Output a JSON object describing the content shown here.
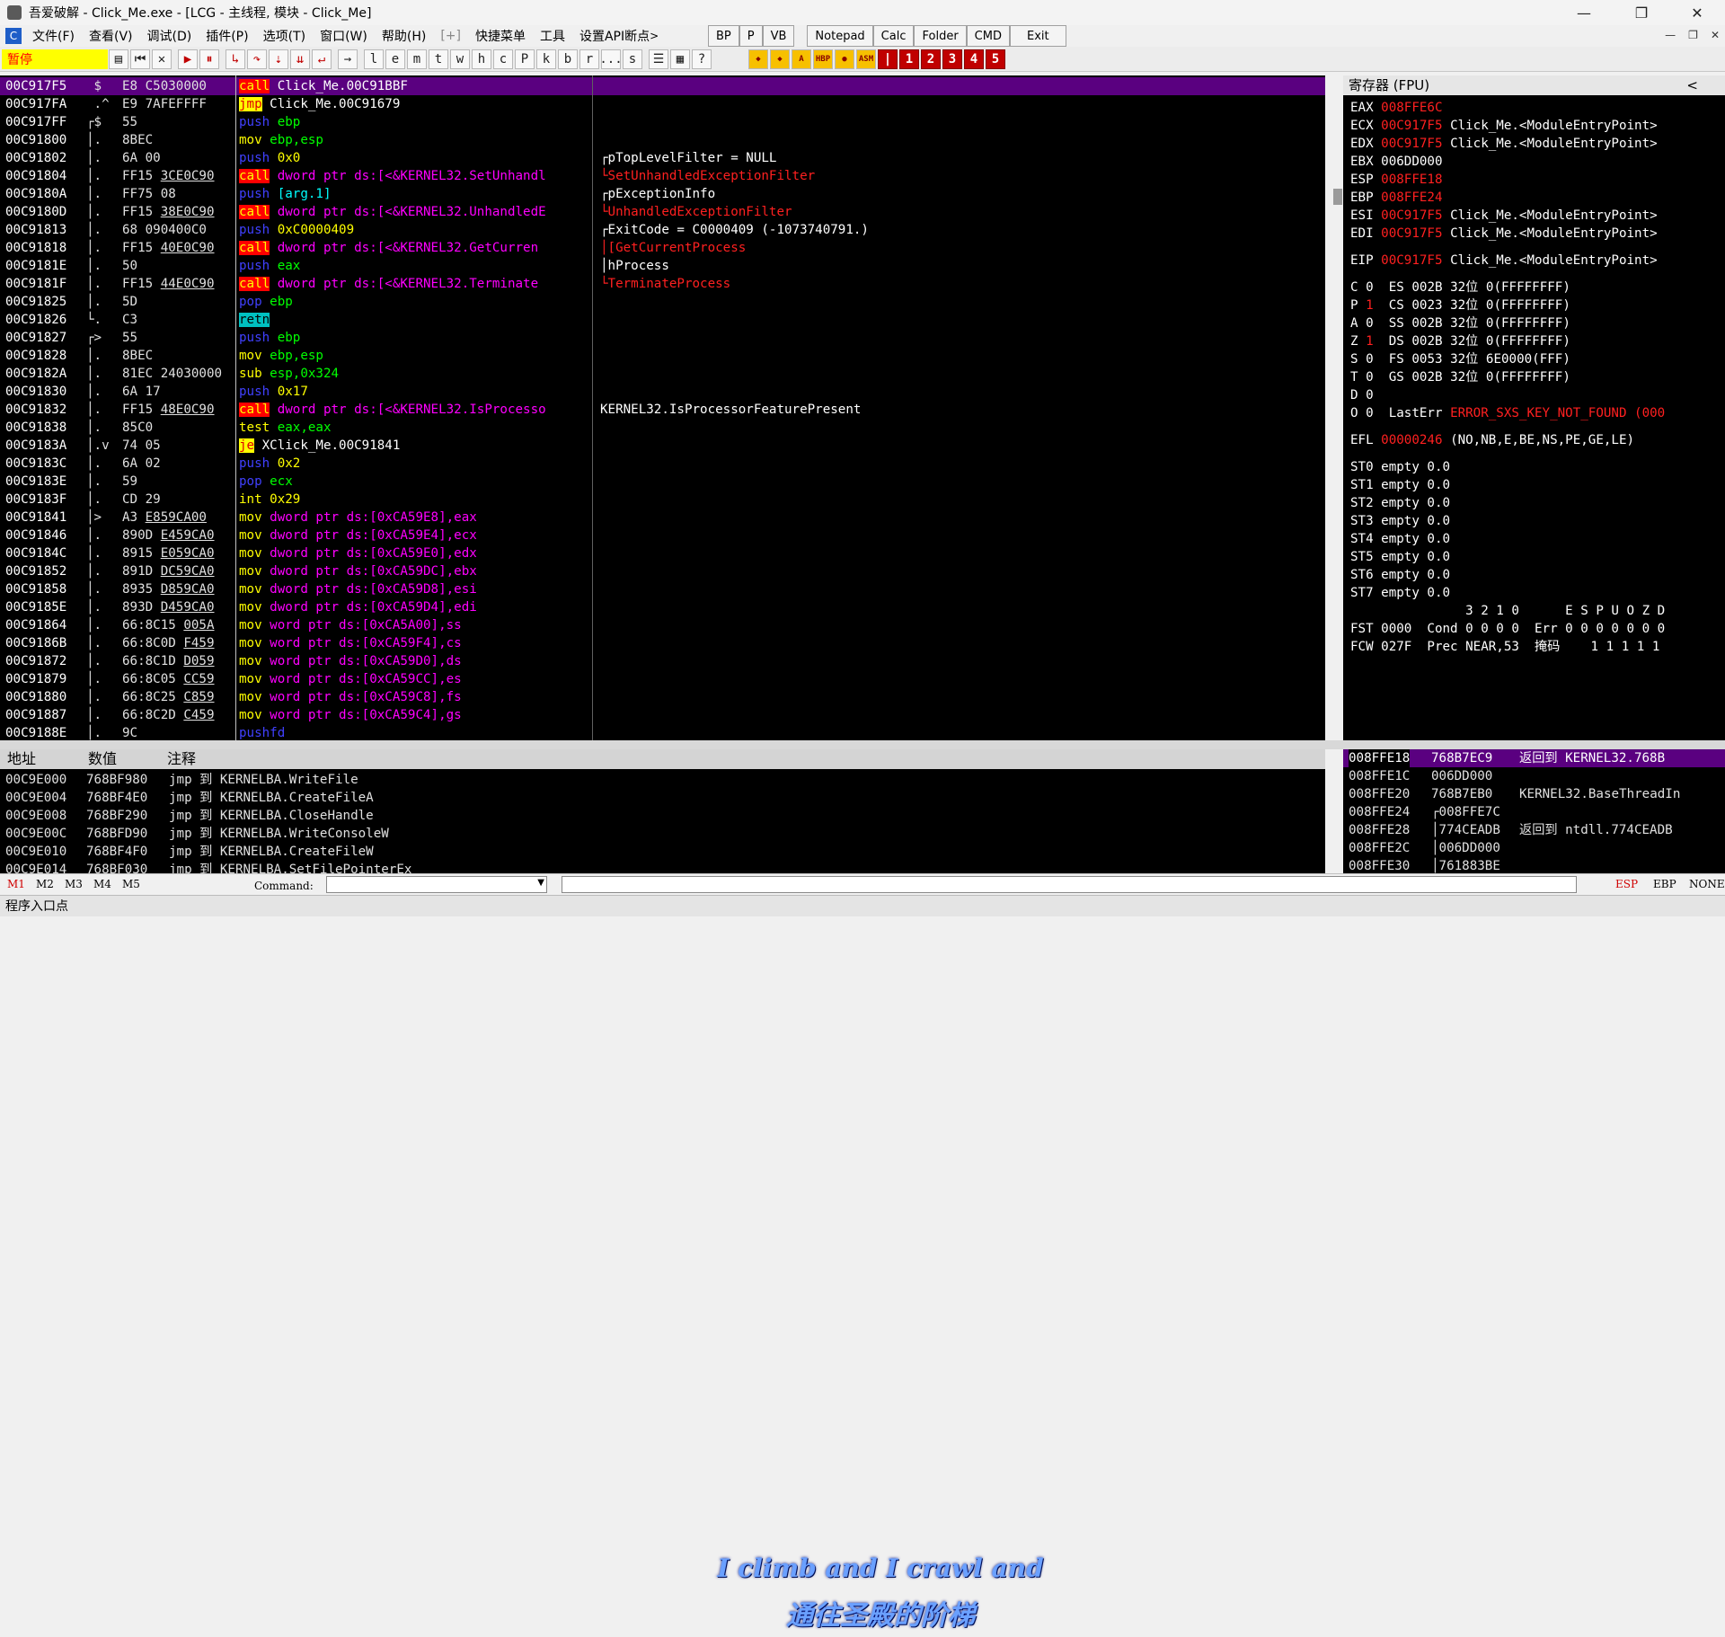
{
  "window": {
    "title": "吾爱破解 - Click_Me.exe - [LCG - 主线程, 模块 - Click_Me]",
    "minimize": "—",
    "maximize": "❐",
    "close": "✕"
  },
  "menu": {
    "app_icon": "C",
    "items": [
      "文件(F)",
      "查看(V)",
      "调试(D)",
      "插件(P)",
      "选项(T)",
      "窗口(W)",
      "帮助(H)",
      "[+]",
      "快捷菜单",
      "工具",
      "设置API断点"
    ],
    "arrow": ">",
    "quick": [
      "BP",
      "P",
      "VB",
      "Notepad",
      "Calc",
      "Folder",
      "CMD",
      "Exit"
    ]
  },
  "toolbar": {
    "status": "暂停",
    "letters": [
      "l",
      "e",
      "m",
      "t",
      "w",
      "h",
      "c",
      "P",
      "k",
      "b",
      "r",
      "...",
      "s"
    ],
    "numbers": [
      "1",
      "2",
      "3",
      "4",
      "5"
    ]
  },
  "cpu_rows": [
    {
      "addr": "00C917F5",
      "jc": " $",
      "hex": "E8 C5030000",
      "ul": "",
      "mn": "call",
      "mc": "call",
      "op": "Click_Me.00C91BBF",
      "oc": "tgt",
      "cm": "",
      "cc": "",
      "sel": true
    },
    {
      "addr": "00C917FA",
      "jc": " .^",
      "hex": "E9 7AFEFFFF",
      "ul": "",
      "mn": "jmp",
      "mc": "jmp",
      "op": "Click_Me.00C91679",
      "oc": "tgt",
      "cm": "",
      "cc": ""
    },
    {
      "addr": "00C917FF",
      "jc": "┌$",
      "hex": "55",
      "ul": "",
      "mn": "push",
      "mc": "push",
      "op": "ebp",
      "oc": "reg",
      "cm": "",
      "cc": ""
    },
    {
      "addr": "00C91800",
      "jc": "│.",
      "hex": "8BEC",
      "ul": "",
      "mn": "mov",
      "mc": "mov",
      "op": "ebp,esp",
      "oc": "reg",
      "cm": "",
      "cc": ""
    },
    {
      "addr": "00C91802",
      "jc": "│.",
      "hex": "6A 00",
      "ul": "",
      "mn": "push",
      "mc": "push",
      "op": "0x0",
      "oc": "num",
      "cm": "┌pTopLevelFilter = NULL",
      "cc": ""
    },
    {
      "addr": "00C91804",
      "jc": "│.",
      "hex": "FF15 ",
      "ul": "3CE0C90",
      "mn": "call",
      "mc": "call",
      "op": "dword ptr ds:[<&KERNEL32.SetUnhandl",
      "oc": "str",
      "cm": "└SetUnhandledExceptionFilter",
      "cc": "red"
    },
    {
      "addr": "00C9180A",
      "jc": "│.",
      "hex": "FF75 08",
      "ul": "",
      "mn": "push",
      "mc": "push",
      "op": "[arg.1]",
      "oc": "arg",
      "cm": "┌pExceptionInfo",
      "cc": ""
    },
    {
      "addr": "00C9180D",
      "jc": "│.",
      "hex": "FF15 ",
      "ul": "38E0C90",
      "mn": "call",
      "mc": "call",
      "op": "dword ptr ds:[<&KERNEL32.UnhandledE",
      "oc": "str",
      "cm": "└UnhandledExceptionFilter",
      "cc": "red"
    },
    {
      "addr": "00C91813",
      "jc": "│.",
      "hex": "68 090400C0",
      "ul": "",
      "mn": "push",
      "mc": "push",
      "op": "0xC0000409",
      "oc": "num",
      "cm": "┌ExitCode = C0000409 (-1073740791.)",
      "cc": ""
    },
    {
      "addr": "00C91818",
      "jc": "│.",
      "hex": "FF15 ",
      "ul": "40E0C90",
      "mn": "call",
      "mc": "call",
      "op": "dword ptr ds:[<&KERNEL32.GetCurren",
      "oc": "str",
      "cm": "│[GetCurrentProcess",
      "cc": "red"
    },
    {
      "addr": "00C9181E",
      "jc": "│.",
      "hex": "50",
      "ul": "",
      "mn": "push",
      "mc": "push",
      "op": "eax",
      "oc": "reg",
      "cm": "│hProcess",
      "cc": ""
    },
    {
      "addr": "00C9181F",
      "jc": "│.",
      "hex": "FF15 ",
      "ul": "44E0C90",
      "mn": "call",
      "mc": "call",
      "op": "dword ptr ds:[<&KERNEL32.Terminate",
      "oc": "str",
      "cm": "└TerminateProcess",
      "cc": "red"
    },
    {
      "addr": "00C91825",
      "jc": "│.",
      "hex": "5D",
      "ul": "",
      "mn": "pop",
      "mc": "pop",
      "op": "ebp",
      "oc": "reg",
      "cm": "",
      "cc": ""
    },
    {
      "addr": "00C91826",
      "jc": "└.",
      "hex": "C3",
      "ul": "",
      "mn": "retn",
      "mc": "retn",
      "op": "",
      "oc": "",
      "cm": "",
      "cc": ""
    },
    {
      "addr": "00C91827",
      "jc": "┌>",
      "hex": "55",
      "ul": "",
      "mn": "push",
      "mc": "push",
      "op": "ebp",
      "oc": "reg",
      "cm": "",
      "cc": ""
    },
    {
      "addr": "00C91828",
      "jc": "│.",
      "hex": "8BEC",
      "ul": "",
      "mn": "mov",
      "mc": "mov",
      "op": "ebp,esp",
      "oc": "reg",
      "cm": "",
      "cc": ""
    },
    {
      "addr": "00C9182A",
      "jc": "│.",
      "hex": "81EC 24030000",
      "ul": "",
      "mn": "sub",
      "mc": "other",
      "op": "esp,0x324",
      "oc": "reg",
      "cm": "",
      "cc": ""
    },
    {
      "addr": "00C91830",
      "jc": "│.",
      "hex": "6A 17",
      "ul": "",
      "mn": "push",
      "mc": "push",
      "op": "0x17",
      "oc": "num",
      "cm": "",
      "cc": ""
    },
    {
      "addr": "00C91832",
      "jc": "│.",
      "hex": "FF15 ",
      "ul": "48E0C90",
      "mn": "call",
      "mc": "call",
      "op": "dword ptr ds:[<&KERNEL32.IsProcesso",
      "oc": "str",
      "cm": "KERNEL32.IsProcessorFeaturePresent",
      "cc": ""
    },
    {
      "addr": "00C91838",
      "jc": "│.",
      "hex": "85C0",
      "ul": "",
      "mn": "test",
      "mc": "other",
      "op": "eax,eax",
      "oc": "reg",
      "cm": "",
      "cc": ""
    },
    {
      "addr": "00C9183A",
      "jc": "│.v",
      "hex": "74 05",
      "ul": "",
      "mn": "je",
      "mc": "je",
      "op": "XClick_Me.00C91841",
      "oc": "tgt",
      "cm": "",
      "cc": ""
    },
    {
      "addr": "00C9183C",
      "jc": "│.",
      "hex": "6A 02",
      "ul": "",
      "mn": "push",
      "mc": "push",
      "op": "0x2",
      "oc": "num",
      "cm": "",
      "cc": ""
    },
    {
      "addr": "00C9183E",
      "jc": "│.",
      "hex": "59",
      "ul": "",
      "mn": "pop",
      "mc": "pop",
      "op": "ecx",
      "oc": "reg",
      "cm": "",
      "cc": ""
    },
    {
      "addr": "00C9183F",
      "jc": "│.",
      "hex": "CD 29",
      "ul": "",
      "mn": "int",
      "mc": "other",
      "op": "0x29",
      "oc": "num",
      "cm": "",
      "cc": ""
    },
    {
      "addr": "00C91841",
      "jc": "│>",
      "hex": "A3 ",
      "ul": "E859CA00",
      "mn": "mov",
      "mc": "mov",
      "op": "dword ptr ds:[0xCA59E8],eax",
      "oc": "str",
      "cm": "",
      "cc": ""
    },
    {
      "addr": "00C91846",
      "jc": "│.",
      "hex": "890D ",
      "ul": "E459CA0",
      "mn": "mov",
      "mc": "mov",
      "op": "dword ptr ds:[0xCA59E4],ecx",
      "oc": "str",
      "cm": "",
      "cc": ""
    },
    {
      "addr": "00C9184C",
      "jc": "│.",
      "hex": "8915 ",
      "ul": "E059CA0",
      "mn": "mov",
      "mc": "mov",
      "op": "dword ptr ds:[0xCA59E0],edx",
      "oc": "str",
      "cm": "",
      "cc": ""
    },
    {
      "addr": "00C91852",
      "jc": "│.",
      "hex": "891D ",
      "ul": "DC59CA0",
      "mn": "mov",
      "mc": "mov",
      "op": "dword ptr ds:[0xCA59DC],ebx",
      "oc": "str",
      "cm": "",
      "cc": ""
    },
    {
      "addr": "00C91858",
      "jc": "│.",
      "hex": "8935 ",
      "ul": "D859CA0",
      "mn": "mov",
      "mc": "mov",
      "op": "dword ptr ds:[0xCA59D8],esi",
      "oc": "str",
      "cm": "",
      "cc": ""
    },
    {
      "addr": "00C9185E",
      "jc": "│.",
      "hex": "893D ",
      "ul": "D459CA0",
      "mn": "mov",
      "mc": "mov",
      "op": "dword ptr ds:[0xCA59D4],edi",
      "oc": "str",
      "cm": "",
      "cc": ""
    },
    {
      "addr": "00C91864",
      "jc": "│.",
      "hex": "66:8C15 ",
      "ul": "005A",
      "mn": "mov",
      "mc": "mov",
      "op": "word ptr ds:[0xCA5A00],ss",
      "oc": "str",
      "cm": "",
      "cc": ""
    },
    {
      "addr": "00C9186B",
      "jc": "│.",
      "hex": "66:8C0D ",
      "ul": "F459",
      "mn": "mov",
      "mc": "mov",
      "op": "word ptr ds:[0xCA59F4],cs",
      "oc": "str",
      "cm": "",
      "cc": ""
    },
    {
      "addr": "00C91872",
      "jc": "│.",
      "hex": "66:8C1D ",
      "ul": "D059",
      "mn": "mov",
      "mc": "mov",
      "op": "word ptr ds:[0xCA59D0],ds",
      "oc": "str",
      "cm": "",
      "cc": ""
    },
    {
      "addr": "00C91879",
      "jc": "│.",
      "hex": "66:8C05 ",
      "ul": "CC59",
      "mn": "mov",
      "mc": "mov",
      "op": "word ptr ds:[0xCA59CC],es",
      "oc": "str",
      "cm": "",
      "cc": ""
    },
    {
      "addr": "00C91880",
      "jc": "│.",
      "hex": "66:8C25 ",
      "ul": "C859",
      "mn": "mov",
      "mc": "mov",
      "op": "word ptr ds:[0xCA59C8],fs",
      "oc": "str",
      "cm": "",
      "cc": ""
    },
    {
      "addr": "00C91887",
      "jc": "│.",
      "hex": "66:8C2D ",
      "ul": "C459",
      "mn": "mov",
      "mc": "mov",
      "op": "word ptr ds:[0xCA59C4],gs",
      "oc": "str",
      "cm": "",
      "cc": ""
    },
    {
      "addr": "00C9188E",
      "jc": "│.",
      "hex": "9C",
      "ul": "",
      "mn": "pushfd",
      "mc": "push",
      "op": "",
      "oc": "",
      "cm": "",
      "cc": ""
    }
  ],
  "registers": {
    "title": "寄存器 (FPU)",
    "collapse": "<",
    "gp": [
      {
        "n": "EAX",
        "v": "008FFE6C",
        "c": ""
      },
      {
        "n": "ECX",
        "v": "00C917F5",
        "c": "Click_Me.<ModuleEntryPoint>"
      },
      {
        "n": "EDX",
        "v": "00C917F5",
        "c": "Click_Me.<ModuleEntryPoint>"
      },
      {
        "n": "EBX",
        "v": "006DD000",
        "c": "",
        "w": true
      },
      {
        "n": "ESP",
        "v": "008FFE18",
        "c": ""
      },
      {
        "n": "EBP",
        "v": "008FFE24",
        "c": ""
      },
      {
        "n": "ESI",
        "v": "00C917F5",
        "c": "Click_Me.<ModuleEntryPoint>"
      },
      {
        "n": "EDI",
        "v": "00C917F5",
        "c": "Click_Me.<ModuleEntryPoint>"
      }
    ],
    "eip": {
      "n": "EIP",
      "v": "00C917F5",
      "c": "Click_Me.<ModuleEntryPoint>"
    },
    "flags": [
      {
        "f": "C",
        "v": "0",
        "s": "ES 002B",
        "b": "32位",
        "x": "0(FFFFFFFF)"
      },
      {
        "f": "P",
        "v": "1",
        "s": "CS 0023",
        "b": "32位",
        "x": "0(FFFFFFFF)"
      },
      {
        "f": "A",
        "v": "0",
        "s": "SS 002B",
        "b": "32位",
        "x": "0(FFFFFFFF)"
      },
      {
        "f": "Z",
        "v": "1",
        "s": "DS 002B",
        "b": "32位",
        "x": "0(FFFFFFFF)"
      },
      {
        "f": "S",
        "v": "0",
        "s": "FS 0053",
        "b": "32位",
        "x": "6E0000(FFF)"
      },
      {
        "f": "T",
        "v": "0",
        "s": "GS 002B",
        "b": "32位",
        "x": "0(FFFFFFFF)"
      }
    ],
    "d_flag": "D 0",
    "o_flag": "O 0",
    "lasterr_label": "LastErr",
    "lasterr": "ERROR_SXS_KEY_NOT_FOUND (000",
    "efl_label": "EFL",
    "efl": "00000246",
    "efl_desc": "(NO,NB,E,BE,NS,PE,GE,LE)",
    "st": [
      "ST0 empty 0.0",
      "ST1 empty 0.0",
      "ST2 empty 0.0",
      "ST3 empty 0.0",
      "ST4 empty 0.0",
      "ST5 empty 0.0",
      "ST6 empty 0.0",
      "ST7 empty 0.0"
    ],
    "fpu_hdr": "               3 2 1 0      E S P U O Z D",
    "fst": "FST 0000  Cond 0 0 0 0  Err 0 0 0 0 0 0 0",
    "fcw": "FCW 027F  Prec NEAR,53  掩码    1 1 1 1 1"
  },
  "dump": {
    "headers": {
      "addr": "地址",
      "value": "数值",
      "comment": "注释"
    },
    "rows": [
      {
        "a": "00C9E000",
        "v": "768BF980",
        "c": "jmp 到 KERNELBA.WriteFile"
      },
      {
        "a": "00C9E004",
        "v": "768BF4E0",
        "c": "jmp 到 KERNELBA.CreateFileA"
      },
      {
        "a": "00C9E008",
        "v": "768BF290",
        "c": "jmp 到 KERNELBA.CloseHandle"
      },
      {
        "a": "00C9E00C",
        "v": "768BFD90",
        "c": "jmp 到 KERNELBA.WriteConsoleW"
      },
      {
        "a": "00C9E010",
        "v": "768BF4F0",
        "c": "jmp 到 KERNELBA.CreateFileW"
      },
      {
        "a": "00C9E014",
        "v": "768BF030",
        "c": "jmp 到 KERNELBA.SetFilePointerEx"
      }
    ]
  },
  "stack": {
    "rows": [
      {
        "a": "008FFE18",
        "v": "768B7EC9",
        "c": "返回到 KERNEL32.768B",
        "sel": true
      },
      {
        "a": "008FFE1C",
        "v": "006DD000",
        "c": ""
      },
      {
        "a": "008FFE20",
        "v": "768B7EB0",
        "c": "KERNEL32.BaseThreadIn"
      },
      {
        "a": "008FFE24",
        "v": "┌008FFE7C",
        "c": ""
      },
      {
        "a": "008FFE28",
        "v": "│774CEADB",
        "c": "返回到 ntdll.774CEADB"
      },
      {
        "a": "008FFE2C",
        "v": "│006DD000",
        "c": ""
      },
      {
        "a": "008FFE30",
        "v": "│761883BE",
        "c": ""
      }
    ]
  },
  "lyrics": {
    "line1": "I climb and I crawl and",
    "line2": "通往圣殿的阶梯"
  },
  "command": {
    "tabs": [
      "M1",
      "M2",
      "M3",
      "M4",
      "M5"
    ],
    "label": "Command:",
    "right": [
      "ESP",
      "EBP",
      "NONE"
    ]
  },
  "status": {
    "text": "程序入口点"
  },
  "colors": {
    "selected_row": "#5a0080",
    "call": "#ff0000",
    "jmp": "#ffff00",
    "pause": "#ffff00"
  }
}
